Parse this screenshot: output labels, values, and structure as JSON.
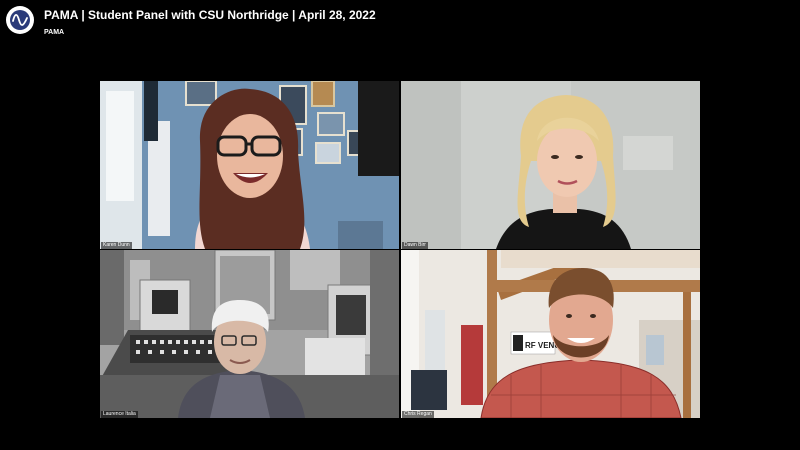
{
  "header": {
    "title": "PAMA | Student Panel with CSU Northridge | April 28, 2022",
    "channel": "PAMA",
    "logo_icon": "waveform-logo-icon"
  },
  "participants": [
    {
      "name": "Karen Dunn"
    },
    {
      "name": "Dawn Birr"
    },
    {
      "name": "Laurence Italia"
    },
    {
      "name": "Chris Regan"
    }
  ],
  "scene_text": {
    "rf_venue_sign": "RF VENUE"
  },
  "colors": {
    "background": "#000000",
    "text": "#ffffff",
    "logo_wave": "#2a3a7a"
  }
}
